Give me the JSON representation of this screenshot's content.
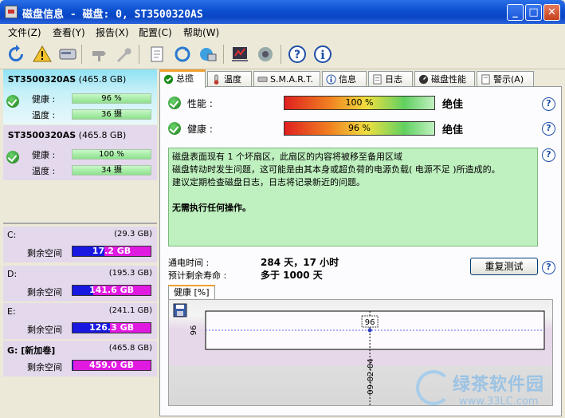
{
  "window": {
    "title": "磁盘信息 - 磁盘: 0, ST3500320AS",
    "minimize_glyph": "_",
    "maximize_glyph": "□",
    "close_glyph": "✕"
  },
  "menu": [
    "文件(Z)",
    "查看(Y)",
    "报告(X)",
    "配置(C)",
    "帮助(W)"
  ],
  "toolbar": {
    "icons": [
      "refresh-icon",
      "warning-icon",
      "disk-icon",
      "tool-icon",
      "wrench-icon",
      "document-icon",
      "recycle-icon",
      "network-icon",
      "checklist-icon",
      "speaker-icon",
      "help-icon",
      "info-icon"
    ]
  },
  "disks": [
    {
      "name": "ST3500320AS",
      "size": "(465.8 GB)",
      "health_label": "健康 :",
      "health": "96 %",
      "temp_label": "温度 :",
      "temp": "36 摄"
    },
    {
      "name": "ST3500320AS",
      "size": "(465.8 GB)",
      "health_label": "健康 :",
      "health": "100 %",
      "temp_label": "温度 :",
      "temp": "34 摄"
    }
  ],
  "volumes": [
    {
      "letter": "C:",
      "size": "(29.3 GB)",
      "free_label": "剩余空间",
      "free": "17.2 GB",
      "used_fraction": 0.41
    },
    {
      "letter": "D:",
      "size": "(195.3 GB)",
      "free_label": "剩余空间",
      "free": "141.6 GB",
      "used_fraction": 0.27
    },
    {
      "letter": "E:",
      "size": "(241.1 GB)",
      "free_label": "剩余空间",
      "free": "126.3 GB",
      "used_fraction": 0.48
    },
    {
      "letter": "G: [新加卷]",
      "size": "(465.8 GB)",
      "free_label": "剩余空间",
      "free": "459.0 GB",
      "used_fraction": 0.01
    }
  ],
  "tabs": [
    "总揽",
    "温度",
    "S.M.A.R.T.",
    "信息",
    "日志",
    "磁盘性能",
    "警示(A)"
  ],
  "overview": {
    "performance_label": "性能 :",
    "performance_value": "100 %",
    "performance_rating": "绝佳",
    "health_label": "健康 :",
    "health_value": "96 %",
    "health_rating": "绝佳",
    "help_glyph": "?",
    "message_lines": [
      "磁盘表面现有 1 个坏扇区，此扇区的内容将被移至备用区域",
      "磁盘转动时发生问题，这可能是由其本身或超负荷的电源负载( 电源不足 )所造成的。",
      "建议定期检查磁盘日志，日志将记录新近的问题。"
    ],
    "message_action": "无需执行任何操作。",
    "power_on_label": "通电时间 :",
    "power_on_value": "284 天，17 小时",
    "life_label": "预计剩余寿命 :",
    "life_value": "多于 1000 天",
    "retest_label": "重复测试",
    "chart_tab_label": "健康 [%]"
  },
  "chart_data": {
    "type": "line",
    "x": [
      "09-02-04"
    ],
    "values": [
      96
    ],
    "y_tick": "96",
    "data_label": "96"
  },
  "watermark": {
    "title": "绿茶软件园",
    "url": "www.33LC.com"
  }
}
